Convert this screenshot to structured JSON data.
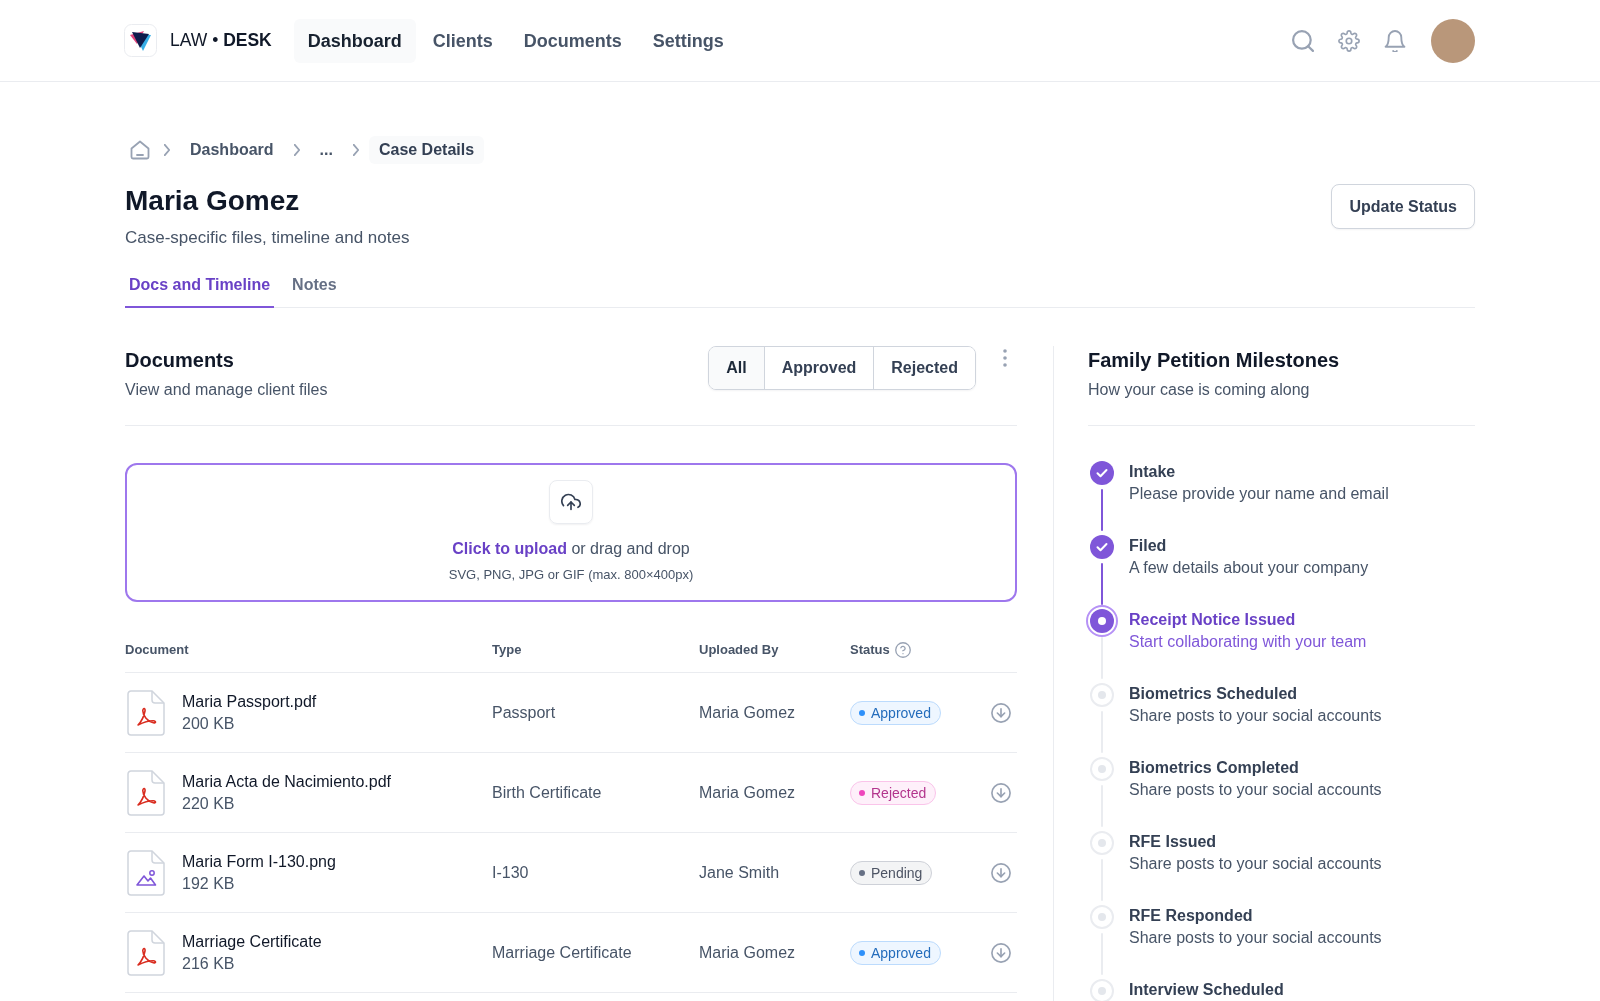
{
  "header": {
    "logo": "LAW • **DESK**",
    "nav": [
      {
        "label": "Dashboard",
        "selected": true
      },
      {
        "label": "Clients",
        "selected": false
      },
      {
        "label": "Documents",
        "selected": false
      },
      {
        "label": "Settings",
        "selected": false
      }
    ]
  },
  "breadcrumb": [
    {
      "label": "Dashboard",
      "current": false
    },
    {
      "label": "...",
      "current": false
    },
    {
      "label": "Case Details",
      "current": true
    }
  ],
  "page": {
    "title": "Maria Gomez",
    "subtitle": "Case-specific files, timeline and notes",
    "action": "Update Status"
  },
  "tabs": [
    {
      "label": "Docs and Timeline",
      "selected": true
    },
    {
      "label": "Notes",
      "selected": false
    }
  ],
  "documents": {
    "title": "Documents",
    "subtitle": "View and manage client files",
    "filters": [
      {
        "label": "All",
        "selected": true
      },
      {
        "label": "Approved",
        "selected": false
      },
      {
        "label": "Rejected",
        "selected": false
      }
    ],
    "upload": {
      "link": "Click to upload",
      "text": "or drag and drop",
      "hint": "SVG, PNG, JPG or GIF (max. 800×400px)"
    },
    "table": {
      "columns": [
        {
          "label": "Document",
          "help": false
        },
        {
          "label": "Type",
          "help": false
        },
        {
          "label": "Uploaded By",
          "help": false
        },
        {
          "label": "Status",
          "help": true
        }
      ],
      "rows": [
        {
          "kind": "pdf",
          "name": "Maria Passport.pdf",
          "size": "200 KB",
          "type": "Passport",
          "uploaded_by": "Maria Gomez",
          "status": {
            "label": "Approved",
            "color": "#2e90fa"
          }
        },
        {
          "kind": "pdf",
          "name": "Maria Acta de Nacimiento.pdf",
          "size": "220 KB",
          "type": "Birth Certificate",
          "uploaded_by": "Maria Gomez",
          "status": {
            "label": "Rejected",
            "color": "#ee46bc"
          }
        },
        {
          "kind": "image",
          "name": "Maria Form I-130.png",
          "size": "192 KB",
          "type": "I-130",
          "uploaded_by": "Jane Smith",
          "status": {
            "label": "Pending",
            "color": "#667085"
          }
        },
        {
          "kind": "pdf",
          "name": "Marriage Certificate",
          "size": "216 KB",
          "type": "Marriage Certificate",
          "uploaded_by": "Maria Gomez",
          "status": {
            "label": "Approved",
            "color": "#2e90fa"
          }
        }
      ]
    }
  },
  "milestones": {
    "title": "Family Petition Milestones",
    "subtitle": "How your case is coming along",
    "steps": [
      {
        "title": "Intake",
        "description": "Please provide your name and email",
        "completed": true,
        "current": false
      },
      {
        "title": "Filed",
        "description": "A few details about your company",
        "completed": true,
        "current": false
      },
      {
        "title": "Receipt Notice Issued",
        "description": "Start collaborating with your team",
        "completed": false,
        "current": true
      },
      {
        "title": "Biometrics Scheduled",
        "description": "Share posts to your social accounts",
        "completed": false,
        "current": false
      },
      {
        "title": "Biometrics Completed",
        "description": "Share posts to your social accounts",
        "completed": false,
        "current": false
      },
      {
        "title": "RFE Issued",
        "description": "Share posts to your social accounts",
        "completed": false,
        "current": false
      },
      {
        "title": "RFE Responded",
        "description": "Share posts to your social accounts",
        "completed": false,
        "current": false
      },
      {
        "title": "Interview Scheduled",
        "completed": false,
        "current": false
      }
    ]
  }
}
